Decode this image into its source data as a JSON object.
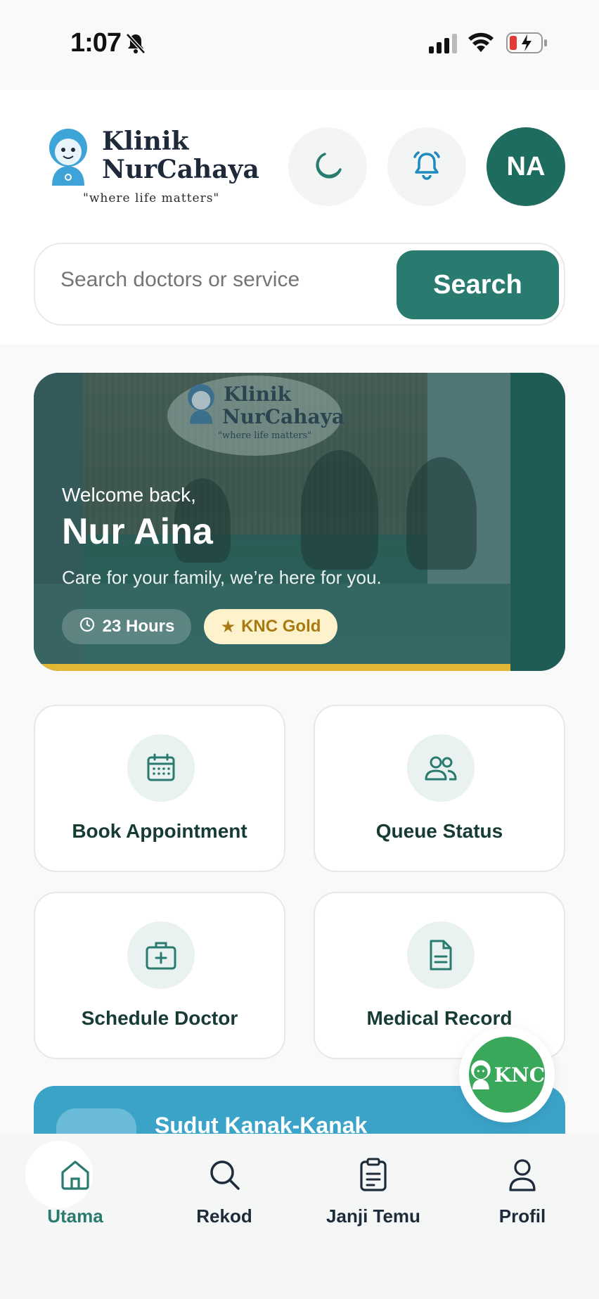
{
  "status_bar": {
    "time": "1:07"
  },
  "header": {
    "logo_line1": "Klinik",
    "logo_line2": "NurCahaya",
    "logo_tagline": "\"where life matters\"",
    "avatar_initials": "NA"
  },
  "search": {
    "placeholder": "Search doctors or service",
    "button_label": "Search"
  },
  "hero": {
    "sign_line1": "Klinik",
    "sign_line2": "NurCahaya",
    "sign_tagline": "\"where life matters\"",
    "welcome": "Welcome back,",
    "name": "Nur Aina",
    "subtitle": "Care for your family, we’re here for you.",
    "hours_chip": "23 Hours",
    "tier_chip": "KNC Gold"
  },
  "tiles": [
    {
      "label": "Book Appointment",
      "icon": "calendar-icon"
    },
    {
      "label": "Queue Status",
      "icon": "users-icon"
    },
    {
      "label": "Schedule Doctor",
      "icon": "medical-kit-icon"
    },
    {
      "label": "Medical Record",
      "icon": "document-icon"
    }
  ],
  "kids_card": {
    "title": "Sudut Kanak-Kanak"
  },
  "fab": {
    "label": "KNC"
  },
  "nav": {
    "items": [
      {
        "label": "Utama",
        "icon": "home-icon",
        "active": true
      },
      {
        "label": "Rekod",
        "icon": "search-icon",
        "active": false
      },
      {
        "label": "Janji Temu",
        "icon": "clipboard-icon",
        "active": false
      },
      {
        "label": "Profil",
        "icon": "user-icon",
        "active": false
      }
    ]
  },
  "colors": {
    "primary": "#2a7b6f",
    "gold": "#e1b733",
    "kids": "#3ba3c8",
    "fab": "#39a85a"
  }
}
